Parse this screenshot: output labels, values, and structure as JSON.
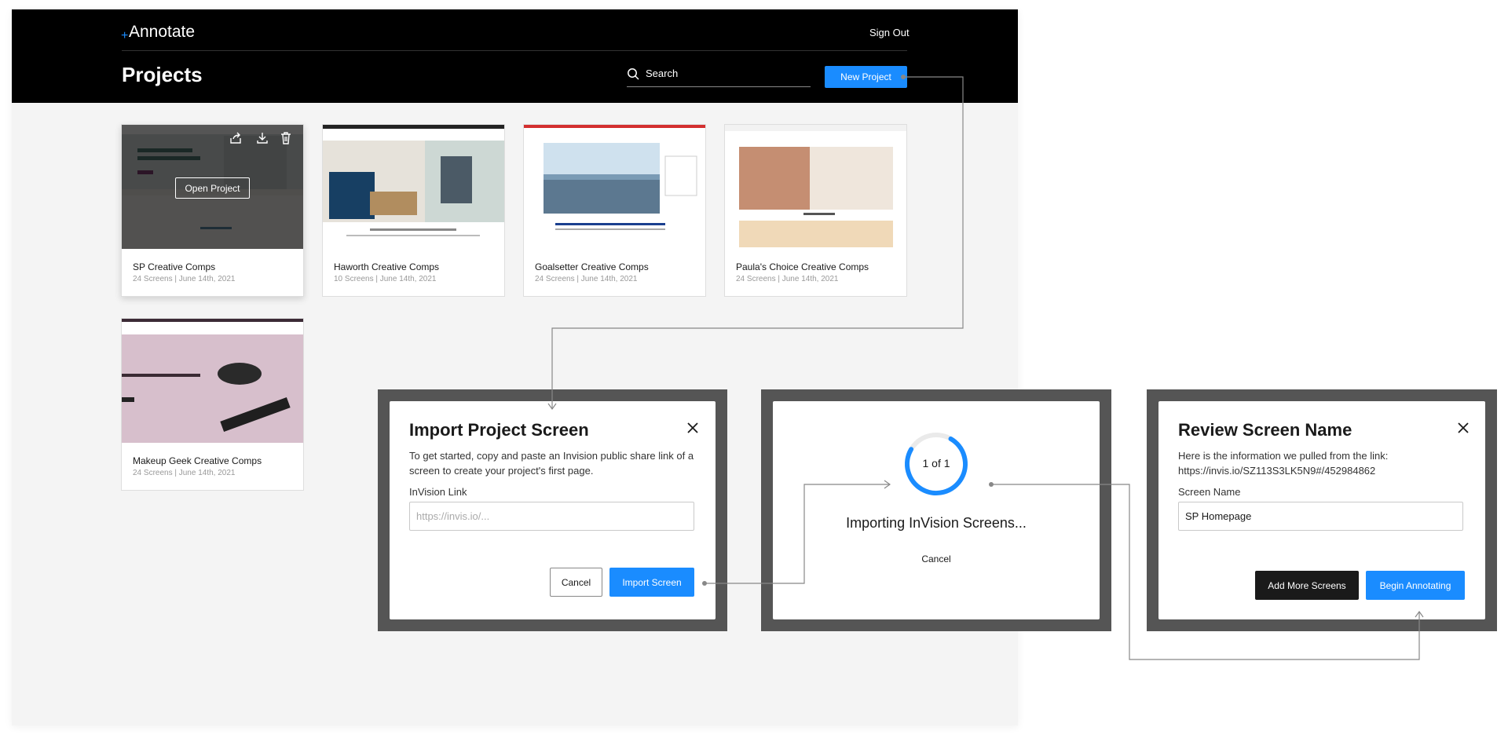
{
  "app": {
    "logo": "Annotate",
    "sign_out": "Sign Out",
    "page_title": "Projects",
    "search_label": "Search",
    "new_project_label": "New Project"
  },
  "projects": [
    {
      "title": "SP Creative Comps",
      "meta": "24 Screens | June 14th, 2021",
      "hover_action": "Open Project"
    },
    {
      "title": "Haworth Creative Comps",
      "meta": "10 Screens | June 14th, 2021"
    },
    {
      "title": "Goalsetter Creative Comps",
      "meta": "24 Screens | June 14th, 2021"
    },
    {
      "title": "Paula's Choice Creative Comps",
      "meta": "24 Screens | June 14th, 2021"
    },
    {
      "title": "Makeup Geek Creative Comps",
      "meta": "24 Screens | June 14th, 2021"
    }
  ],
  "import_modal": {
    "title": "Import Project Screen",
    "description": "To get started, copy and paste an Invision public share link of a screen to create your project's first page.",
    "field_label": "InVision Link",
    "placeholder": "https://invis.io/...",
    "cancel_label": "Cancel",
    "submit_label": "Import Screen"
  },
  "progress_modal": {
    "counter": "1 of 1",
    "progress_fraction": 0.75,
    "status": "Importing InVision Screens...",
    "cancel_label": "Cancel"
  },
  "review_modal": {
    "title": "Review Screen Name",
    "description": "Here is the information we pulled from the link: https://invis.io/SZ113S3LK5N9#/452984862",
    "field_label": "Screen Name",
    "value": "SP Homepage",
    "add_more_label": "Add More Screens",
    "begin_label": "Begin Annotating"
  },
  "colors": {
    "accent": "#1a8cff",
    "topbar": "#000000",
    "canvas": "#f4f4f4",
    "modal_frame": "#555555"
  }
}
